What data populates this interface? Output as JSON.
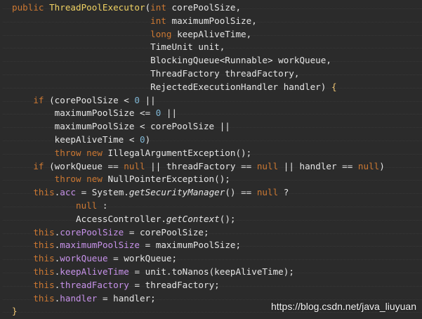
{
  "code_lines": [
    [
      [
        "kw",
        "public "
      ],
      [
        "fn",
        "ThreadPoolExecutor"
      ],
      [
        "pl",
        "("
      ],
      [
        "kw",
        "int "
      ],
      [
        "pl",
        "corePoolSize,"
      ]
    ],
    [
      [
        "pl",
        "                          "
      ],
      [
        "kw",
        "int "
      ],
      [
        "pl",
        "maximumPoolSize,"
      ]
    ],
    [
      [
        "pl",
        "                          "
      ],
      [
        "kw",
        "long "
      ],
      [
        "pl",
        "keepAliveTime,"
      ]
    ],
    [
      [
        "pl",
        "                          "
      ],
      [
        "pl",
        "TimeUnit unit,"
      ]
    ],
    [
      [
        "pl",
        "                          "
      ],
      [
        "pl",
        "BlockingQueue<Runnable> workQueue,"
      ]
    ],
    [
      [
        "pl",
        "                          "
      ],
      [
        "pl",
        "ThreadFactory threadFactory,"
      ]
    ],
    [
      [
        "pl",
        "                          "
      ],
      [
        "pl",
        "RejectedExecutionHandler handler) "
      ],
      [
        "bracket",
        "{"
      ]
    ],
    [
      [
        "pl",
        "    "
      ],
      [
        "kw",
        "if "
      ],
      [
        "pl",
        "(corePoolSize < "
      ],
      [
        "num",
        "0"
      ],
      [
        "pl",
        " ||"
      ]
    ],
    [
      [
        "pl",
        "        "
      ],
      [
        "pl",
        "maximumPoolSize <= "
      ],
      [
        "num",
        "0"
      ],
      [
        "pl",
        " ||"
      ]
    ],
    [
      [
        "pl",
        "        "
      ],
      [
        "pl",
        "maximumPoolSize < corePoolSize ||"
      ]
    ],
    [
      [
        "pl",
        "        "
      ],
      [
        "pl",
        "keepAliveTime < "
      ],
      [
        "num",
        "0"
      ],
      [
        "pl",
        ")"
      ]
    ],
    [
      [
        "pl",
        "        "
      ],
      [
        "kw",
        "throw new "
      ],
      [
        "pl",
        "IllegalArgumentException();"
      ]
    ],
    [
      [
        "pl",
        "    "
      ],
      [
        "kw",
        "if "
      ],
      [
        "pl",
        "(workQueue == "
      ],
      [
        "kw",
        "null"
      ],
      [
        "pl",
        " || threadFactory == "
      ],
      [
        "kw",
        "null"
      ],
      [
        "pl",
        " || handler == "
      ],
      [
        "kw",
        "null"
      ],
      [
        "pl",
        ")"
      ]
    ],
    [
      [
        "pl",
        "        "
      ],
      [
        "kw",
        "throw new "
      ],
      [
        "pl",
        "NullPointerException();"
      ]
    ],
    [
      [
        "pl",
        "    "
      ],
      [
        "kw",
        "this"
      ],
      [
        "pl",
        "."
      ],
      [
        "fld",
        "acc"
      ],
      [
        "pl",
        " = System."
      ],
      [
        "it",
        "getSecurityManager"
      ],
      [
        "pl",
        "() == "
      ],
      [
        "kw",
        "null"
      ],
      [
        "pl",
        " ?"
      ]
    ],
    [
      [
        "pl",
        "            "
      ],
      [
        "kw",
        "null"
      ],
      [
        "pl",
        " :"
      ]
    ],
    [
      [
        "pl",
        "            "
      ],
      [
        "pl",
        "AccessController."
      ],
      [
        "it",
        "getContext"
      ],
      [
        "pl",
        "();"
      ]
    ],
    [
      [
        "pl",
        "    "
      ],
      [
        "kw",
        "this"
      ],
      [
        "pl",
        "."
      ],
      [
        "fld",
        "corePoolSize"
      ],
      [
        "pl",
        " = corePoolSize;"
      ]
    ],
    [
      [
        "pl",
        "    "
      ],
      [
        "kw",
        "this"
      ],
      [
        "pl",
        "."
      ],
      [
        "fld",
        "maximumPoolSize"
      ],
      [
        "pl",
        " = maximumPoolSize;"
      ]
    ],
    [
      [
        "pl",
        "    "
      ],
      [
        "kw",
        "this"
      ],
      [
        "pl",
        "."
      ],
      [
        "fld",
        "workQueue"
      ],
      [
        "pl",
        " = workQueue;"
      ]
    ],
    [
      [
        "pl",
        "    "
      ],
      [
        "kw",
        "this"
      ],
      [
        "pl",
        "."
      ],
      [
        "fld",
        "keepAliveTime"
      ],
      [
        "pl",
        " = unit.toNanos(keepAliveTime);"
      ]
    ],
    [
      [
        "pl",
        "    "
      ],
      [
        "kw",
        "this"
      ],
      [
        "pl",
        "."
      ],
      [
        "fld",
        "threadFactory"
      ],
      [
        "pl",
        " = threadFactory;"
      ]
    ],
    [
      [
        "pl",
        "    "
      ],
      [
        "kw",
        "this"
      ],
      [
        "pl",
        "."
      ],
      [
        "fld",
        "handler"
      ],
      [
        "pl",
        " = handler;"
      ]
    ],
    [
      [
        "bracket",
        "}"
      ]
    ]
  ],
  "watermark": "https://blog.csdn.net/java_liuyuan"
}
